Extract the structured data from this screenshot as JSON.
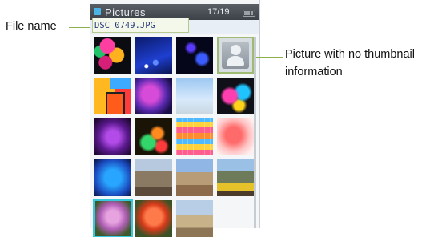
{
  "labels": {
    "file_name": "File name",
    "no_thumbnail_line1": "Picture with no thumbnail",
    "no_thumbnail_line2": "information"
  },
  "header": {
    "title": "Pictures",
    "counter": "17/19"
  },
  "file_bar": {
    "filename": "DSC_0749.JPG"
  },
  "colors": {
    "accent_highlight": "#36c9de",
    "callout_line": "#8bb04d"
  },
  "thumbnails": [
    {
      "name": "thumb-1",
      "row": 0,
      "col": 0
    },
    {
      "name": "thumb-2",
      "row": 0,
      "col": 1
    },
    {
      "name": "thumb-3",
      "row": 0,
      "col": 2
    },
    {
      "name": "thumb-no-info",
      "row": 0,
      "col": 3,
      "placeholder": true
    },
    {
      "name": "thumb-5",
      "row": 1,
      "col": 0
    },
    {
      "name": "thumb-6",
      "row": 1,
      "col": 1
    },
    {
      "name": "thumb-7",
      "row": 1,
      "col": 2
    },
    {
      "name": "thumb-8",
      "row": 1,
      "col": 3
    },
    {
      "name": "thumb-9",
      "row": 2,
      "col": 0
    },
    {
      "name": "thumb-10",
      "row": 2,
      "col": 1
    },
    {
      "name": "thumb-11",
      "row": 2,
      "col": 2
    },
    {
      "name": "thumb-12",
      "row": 2,
      "col": 3
    },
    {
      "name": "thumb-13",
      "row": 3,
      "col": 0
    },
    {
      "name": "thumb-14",
      "row": 3,
      "col": 1
    },
    {
      "name": "thumb-15",
      "row": 3,
      "col": 2
    },
    {
      "name": "thumb-16",
      "row": 3,
      "col": 3
    },
    {
      "name": "thumb-17",
      "row": 4,
      "col": 0,
      "selected": true
    },
    {
      "name": "thumb-18",
      "row": 4,
      "col": 1
    },
    {
      "name": "thumb-19",
      "row": 4,
      "col": 2
    }
  ]
}
